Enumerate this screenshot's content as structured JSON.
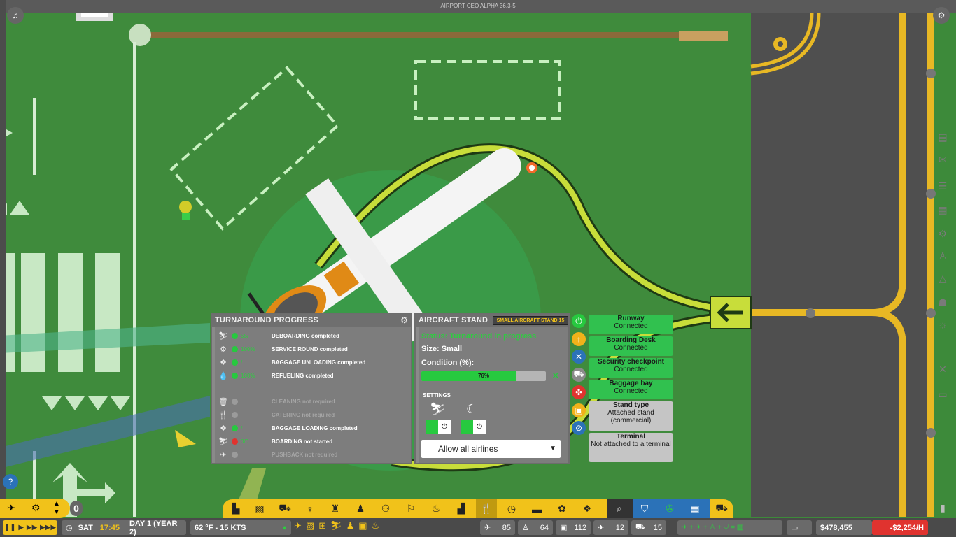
{
  "window": {
    "title": "AIRPORT CEO ALPHA 36.3-5"
  },
  "turnaround": {
    "title": "TURNAROUND PROGRESS",
    "rows": [
      {
        "icon": "deboarding-icon",
        "glyph": "⛷",
        "status": "green",
        "pct": "55/",
        "text": "DEBOARDING completed",
        "dim": false
      },
      {
        "icon": "service-round-icon",
        "glyph": "⚙",
        "status": "green",
        "pct": "100%",
        "text": "SERVICE ROUND completed",
        "dim": false
      },
      {
        "icon": "baggage-unload-icon",
        "glyph": "❖",
        "status": "green",
        "pct": "/",
        "text": "BAGGAGE UNLOADING completed",
        "dim": false
      },
      {
        "icon": "refuel-icon",
        "glyph": "💧",
        "status": "green",
        "pct": "100%",
        "text": "REFUELING completed",
        "dim": false
      },
      {
        "icon": "cleaning-icon",
        "glyph": "🗑",
        "status": "gray",
        "pct": "",
        "text": "CLEANING not required",
        "dim": true
      },
      {
        "icon": "catering-icon",
        "glyph": "🍴",
        "status": "gray",
        "pct": "",
        "text": "CATERING not required",
        "dim": true
      },
      {
        "icon": "baggage-load-icon",
        "glyph": "❖",
        "status": "green",
        "pct": "/",
        "text": "BAGGAGE LOADING completed",
        "dim": false
      },
      {
        "icon": "boarding-icon",
        "glyph": "⛷",
        "status": "red",
        "pct": "0/0",
        "text": "BOARDING not started",
        "dim": false
      },
      {
        "icon": "pushback-icon",
        "glyph": "✈",
        "status": "gray",
        "pct": "",
        "text": "PUSHBACK not required",
        "dim": true
      }
    ]
  },
  "stand": {
    "title": "AIRCRAFT STAND",
    "badge": "SMALL AIRCRAFT STAND 15",
    "status": "Status: Turnaround in progress",
    "size": "Size: Small",
    "condition_label": "Condition (%):",
    "condition_value": 0.76,
    "condition_text": "76%",
    "settings_label": "SETTINGS",
    "airline_filter": "Allow all airlines"
  },
  "connections": [
    {
      "title": "Runway",
      "sub": "Connected",
      "state": "green"
    },
    {
      "title": "Boarding Desk",
      "sub": "Connected",
      "state": "green"
    },
    {
      "title": "Security checkpoint",
      "sub": "Connected",
      "state": "green"
    },
    {
      "title": "Baggage bay",
      "sub": "Connected",
      "state": "green"
    },
    {
      "title": "Stand type",
      "sub": "Attached stand (commercial)",
      "state": "gray"
    },
    {
      "title": "Terminal",
      "sub": "Not attached to a terminal",
      "state": "gray"
    }
  ],
  "side_buttons": [
    {
      "name": "power-button",
      "glyph": "⏻",
      "color": "#27c93f"
    },
    {
      "name": "upgrade-button",
      "glyph": "↑",
      "color": "#f1b21a"
    },
    {
      "name": "repair-button",
      "glyph": "✕",
      "color": "#2b72b8"
    },
    {
      "name": "jetbridge-button",
      "glyph": "⛟",
      "color": "#8a8a8a"
    },
    {
      "name": "fan-button",
      "glyph": "✤",
      "color": "#e0332f"
    },
    {
      "name": "baggage-button",
      "glyph": "▣",
      "color": "#f1b21a"
    },
    {
      "name": "no-fuel-button",
      "glyph": "⊘",
      "color": "#2b72b8"
    }
  ],
  "bottom": {
    "day": "SAT",
    "time": "17:45",
    "date": "DAY 1 (YEAR 2)",
    "weather": "62 °F - 15 KTS",
    "counts": [
      "85",
      "64",
      "112",
      "12",
      "15"
    ],
    "money": "$478,455",
    "rate": "-$2,254/H",
    "speed_counter": "0"
  },
  "colors": {
    "grass": "#3d8a3a",
    "accent_yellow": "#f1c21a",
    "ok_green": "#31c14f",
    "bad_red": "#e0332f"
  }
}
